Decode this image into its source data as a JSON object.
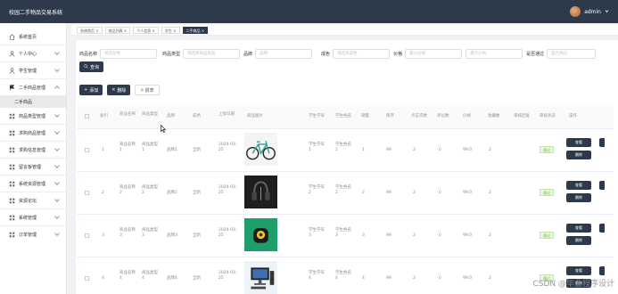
{
  "app_title": "校园二手物品交易系统",
  "user": {
    "name": "admin"
  },
  "sidebar": {
    "items": [
      {
        "label": "系统首页",
        "icon": "home-icon"
      },
      {
        "label": "个人中心",
        "icon": "user-icon"
      },
      {
        "label": "学生管理",
        "icon": "user-icon"
      },
      {
        "label": "二手商品管理",
        "icon": "flag-icon"
      },
      {
        "label": "商品类型管理",
        "icon": "grid-icon"
      },
      {
        "label": "求购商品管理",
        "icon": "grid-icon"
      },
      {
        "label": "求购信息管理",
        "icon": "grid-icon"
      },
      {
        "label": "留言板管理",
        "icon": "grid-icon"
      },
      {
        "label": "系统资源管理",
        "icon": "grid-icon"
      },
      {
        "label": "资源论坛",
        "icon": "grid-icon"
      },
      {
        "label": "系统管理",
        "icon": "grid-icon"
      },
      {
        "label": "订单管理",
        "icon": "grid-icon"
      }
    ],
    "sub_item": "二手商品"
  },
  "tabs": [
    "系统首页 ×",
    "商品列表 ×",
    "个人信息 ×",
    "学生 ×",
    "二手商品 ×"
  ],
  "search": {
    "fields": [
      {
        "label": "商品名称",
        "placeholder": "商品名称"
      },
      {
        "label": "商品类型",
        "placeholder": "请选择商品类型"
      },
      {
        "label": "品牌",
        "placeholder": "品牌"
      },
      {
        "label": "成色",
        "placeholder": "请选择成色"
      },
      {
        "label": "价格",
        "placeholder": "最小价格"
      },
      {
        "label": "",
        "placeholder": "最大价格"
      },
      {
        "label": "是否通过",
        "placeholder": "是否通过"
      }
    ],
    "query_button": "查询"
  },
  "toolbar": {
    "add": "添加",
    "delete": "删除",
    "report": "报表"
  },
  "table": {
    "headers": [
      "索引",
      "商品名称",
      "商品类型",
      "品牌",
      "成色",
      "上架日期",
      "商品图片",
      "学生学号",
      "学生姓名",
      "销量",
      "库存",
      "点击次数",
      "评论数",
      "价格",
      "收藏数",
      "审核回复",
      "审核状态",
      "操作"
    ],
    "rows": [
      {
        "index": "1",
        "name": "商品名称1",
        "type": "商品类型1",
        "brand": "品牌1",
        "condition": "全新",
        "date": "2024-03-25",
        "image": "bicycle",
        "stu_no": "学生学号1",
        "stu_name": "学生姓名1",
        "sales": "1",
        "stock": "99",
        "clicks": "2",
        "comments": "0",
        "price": "99.0",
        "favorites": "2",
        "status": "通过"
      },
      {
        "index": "2",
        "name": "商品名称2",
        "type": "商品类型2",
        "brand": "品牌2",
        "condition": "全新",
        "date": "2024-03-25",
        "image": "headphones",
        "stu_no": "学生学号2",
        "stu_name": "学生姓名2",
        "sales": "2",
        "stock": "99",
        "clicks": "2",
        "comments": "0",
        "price": "99.0",
        "favorites": "2",
        "status": "通过"
      },
      {
        "index": "3",
        "name": "商品名称3",
        "type": "商品类型3",
        "brand": "品牌3",
        "condition": "全新",
        "date": "2024-03-25",
        "image": "camera",
        "stu_no": "学生学号3",
        "stu_name": "学生姓名3",
        "sales": "3",
        "stock": "99",
        "clicks": "2",
        "comments": "0",
        "price": "99.0",
        "favorites": "2",
        "status": "通过"
      },
      {
        "index": "4",
        "name": "商品名称4",
        "type": "商品类型4",
        "brand": "品牌4",
        "condition": "全新",
        "date": "2024-03-25",
        "image": "computer",
        "stu_no": "学生学号4",
        "stu_name": "学生姓名4",
        "sales": "4",
        "stock": "99",
        "clicks": "2",
        "comments": "0",
        "price": "99.0",
        "favorites": "2",
        "status": "通过"
      }
    ],
    "view_label": "查看",
    "delete_label": "删除"
  },
  "watermark": "CSDN @毕业程序设计",
  "colors": {
    "primary": "#2d3a4b",
    "tag_bg": "#e8f7e1",
    "tag_text": "#67c23a"
  }
}
